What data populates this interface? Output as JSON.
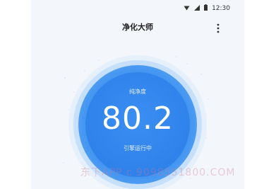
{
  "status_bar": {
    "time": "12:30",
    "icons": [
      "wifi-icon",
      "signal-icon",
      "battery-icon"
    ]
  },
  "app": {
    "title": "净化大师",
    "menu_icon": "more-vertical-icon"
  },
  "dial": {
    "label": "纯净度",
    "value": "80.2",
    "status": "引擎运行中",
    "colors": {
      "primary": "#2f82ea",
      "halo": "#a0cdfa"
    }
  },
  "watermark": {
    "text": "东下APP c 9098551800.COM"
  }
}
